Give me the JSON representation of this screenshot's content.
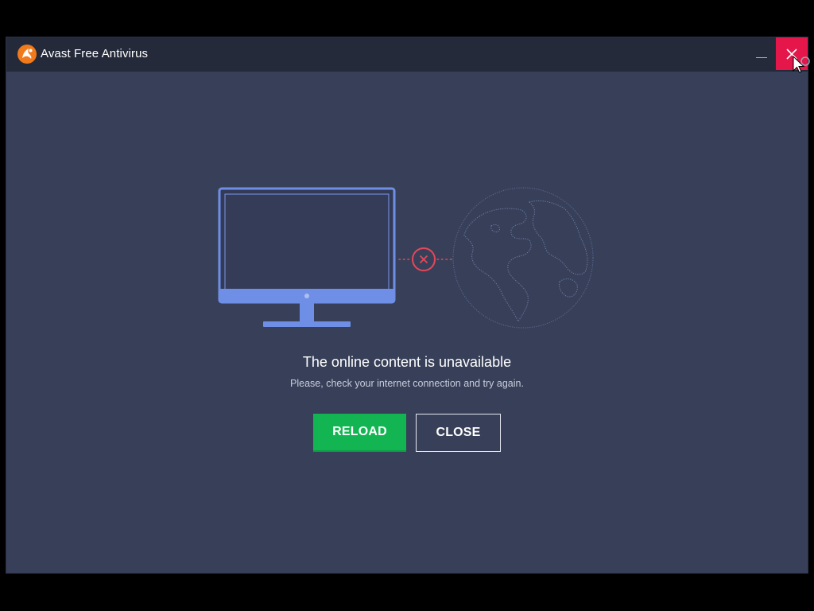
{
  "window": {
    "title": "Avast Free Antivirus",
    "logo_icon": "avast-logo",
    "controls": {
      "minimize_icon": "minimize-icon",
      "close_icon": "close-icon",
      "close_hover_color": "#e5164a"
    }
  },
  "illustration": {
    "computer_icon": "monitor-icon",
    "connection_status_icon": "disconnected-x-icon",
    "internet_icon": "globe-icon",
    "accent_color": "#6f8fe6",
    "error_color": "#e5475a"
  },
  "message": {
    "headline": "The online content is unavailable",
    "subtext": "Please, check your internet connection and try again."
  },
  "actions": {
    "reload_label": "RELOAD",
    "close_label": "CLOSE",
    "reload_color": "#12b552"
  }
}
